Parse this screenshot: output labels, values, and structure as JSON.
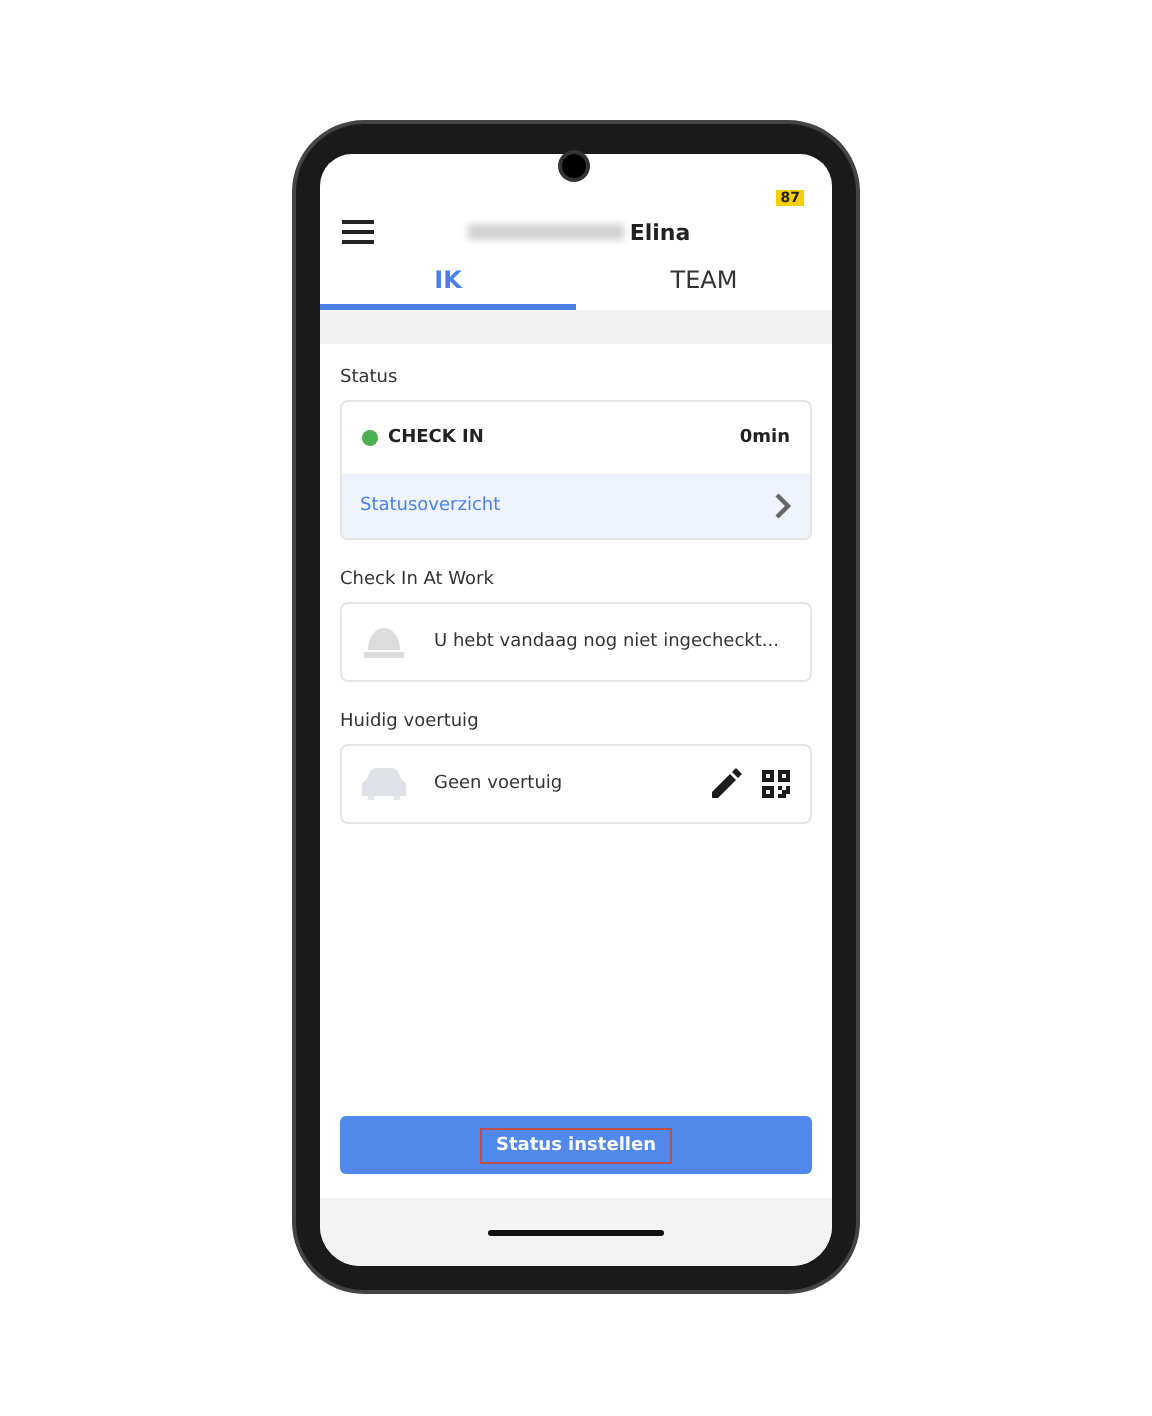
{
  "status_bar": {
    "badge": "87"
  },
  "header": {
    "name_blurred": true,
    "name": "Elina"
  },
  "tabs": [
    {
      "label": "IK",
      "selected": true
    },
    {
      "label": "TEAM",
      "selected": false
    }
  ],
  "status": {
    "label": "Status",
    "state": "CHECK IN",
    "color": "#4caf50",
    "duration": "0min",
    "link": "Statusoverzicht"
  },
  "check_in": {
    "label": "Check In At Work",
    "message": "U hebt vandaag nog niet ingecheckt..."
  },
  "vehicle": {
    "label": "Huidig voertuig",
    "value": "Geen voertuig"
  },
  "action_button": {
    "label": "Status instellen",
    "highlighted": true
  }
}
